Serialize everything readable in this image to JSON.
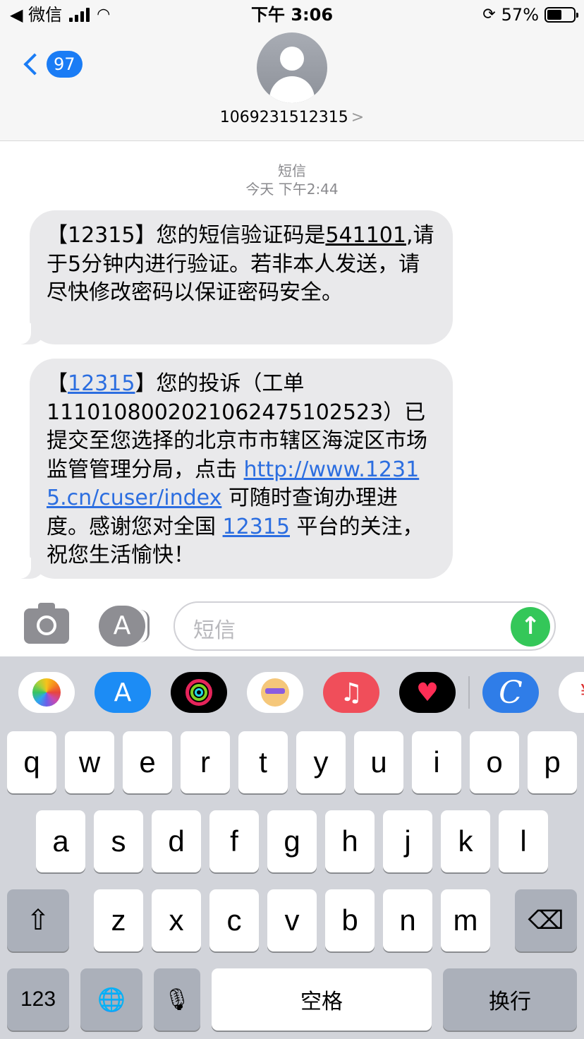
{
  "status_bar": {
    "back_app": "◀ 微信",
    "time": "下午 3:06",
    "battery_percent": "57%",
    "battery_level": 0.57
  },
  "header": {
    "back_count": "97",
    "contact_number": "1069231512315",
    "contact_arrow": ">"
  },
  "conversation": {
    "service_label": "短信",
    "timestamp": "今天 下午2:44",
    "messages": [
      {
        "parts": [
          "【12315】您的短信验证码是",
          "541101",
          ",请于5分钟内进行验证。若非本人发送，请尽快修改密码以保证密码安全。"
        ]
      },
      {
        "parts": [
          "【",
          "12315",
          "】您的投诉（工单111010800202106247510252​3）已提交至您选择的北京市市辖区海淀区市场监管管理分局，点击 ",
          "http://www.12315.cn/cuser/index",
          " 可随时查询办理进度。感谢您对全国 ",
          "12315",
          " 平台的关注，祝您生活愉快！"
        ]
      }
    ]
  },
  "input_bar": {
    "placeholder": "短信",
    "send_symbol": "↑"
  },
  "apps": [
    "photos-app",
    "app-store",
    "activity",
    "memoji-stickers",
    "music",
    "digital-touch",
    "c-app",
    "partial-app"
  ],
  "keyboard": {
    "row1": [
      "q",
      "w",
      "e",
      "r",
      "t",
      "y",
      "u",
      "i",
      "o",
      "p"
    ],
    "row2": [
      "a",
      "s",
      "d",
      "f",
      "g",
      "h",
      "j",
      "k",
      "l"
    ],
    "row3": [
      "z",
      "x",
      "c",
      "v",
      "b",
      "n",
      "m"
    ],
    "shift_symbol": "⇧",
    "delete_symbol": "⌫",
    "numbers_label": "123",
    "globe_symbol": "🌐",
    "mic_symbol": "🎙",
    "space_label": "空格",
    "return_label": "换行"
  },
  "colors": {
    "accent_blue": "#1a7cf5",
    "link_blue": "#2c6ee0",
    "send_green": "#34c759",
    "bubble_gray": "#e9e9eb"
  }
}
